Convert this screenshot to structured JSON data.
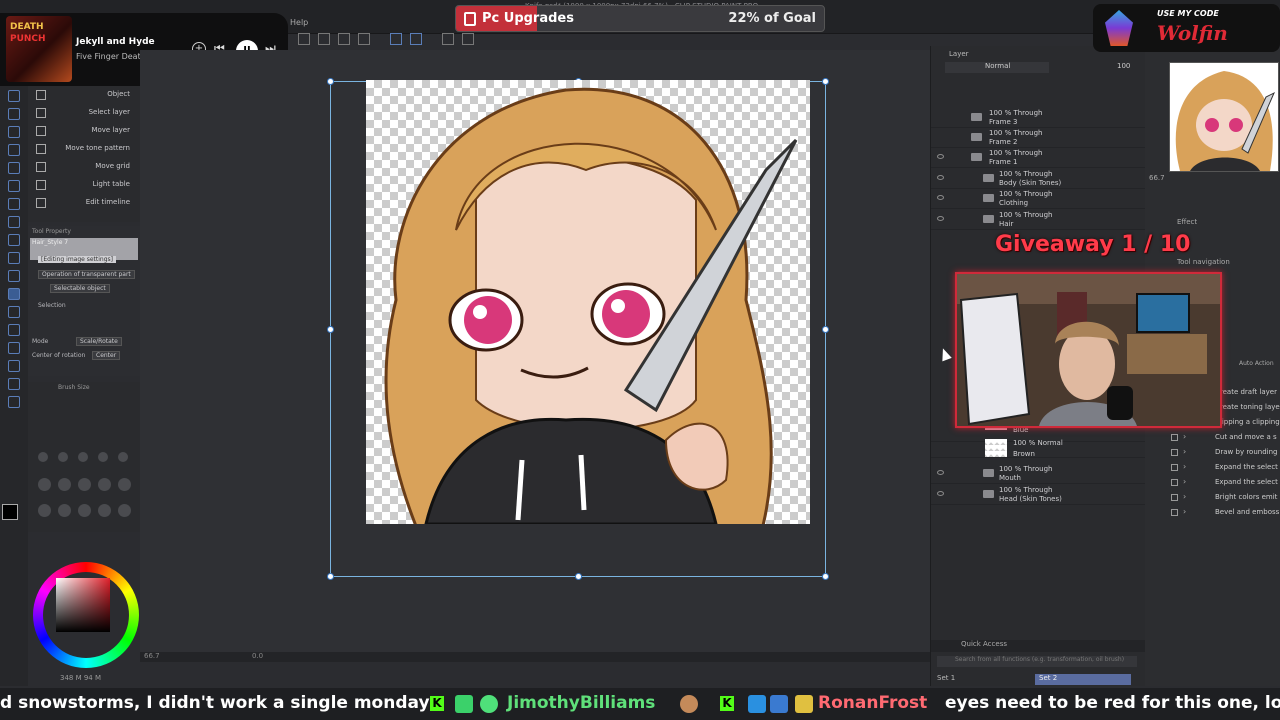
{
  "app": {
    "menu_help": "Help",
    "window_title": "Knife.psd* (1000 x 1000px 72dpi 66.7%) - CLIP STUDIO PAINT PRO"
  },
  "goal": {
    "label": "Pc Upgrades",
    "percent_text": "22% of Goal",
    "progress": 0.22,
    "fill_color": "#c3303a"
  },
  "music": {
    "album_line1": "DEATH",
    "album_line2": "PUNCH",
    "title": "Jekyll and Hyde",
    "artist": "Five Finger Death Punch",
    "controls": {
      "add": "+",
      "prev": "⏮",
      "pause": "II",
      "next": "⏭"
    }
  },
  "subtools": [
    {
      "label": "Object",
      "icon": "arrow-icon"
    },
    {
      "label": "Select layer",
      "icon": "select-layer-icon"
    },
    {
      "label": "Move layer",
      "icon": "move-icon"
    },
    {
      "label": "Move tone pattern",
      "icon": "move-icon"
    },
    {
      "label": "Move grid",
      "icon": "move-icon"
    },
    {
      "label": "Light table",
      "icon": "light-table-icon"
    },
    {
      "label": "Edit timeline",
      "icon": "timeline-icon"
    }
  ],
  "tool_property": {
    "title": "Tool Property",
    "preset": "Hair_Style 7",
    "editing": "[Editing image settings]",
    "operation": "Operation of transparent part",
    "selectable": "Selectable object",
    "selection_label": "Selection",
    "mode_label": "Mode",
    "mode_value": "Scale/Rotate",
    "center_label": "Center of rotation",
    "center_value": "Center"
  },
  "brush_size": {
    "title": "Brush Size"
  },
  "status_left": {
    "coords": "348 M  94 M",
    "value": "0"
  },
  "canvas": {
    "zoom": "66.7",
    "angle": "0.0"
  },
  "layers": {
    "tab": "Layer",
    "blend_mode": "Normal",
    "opacity": "100",
    "rows": [
      {
        "line1": "100 % Through",
        "line2": "Frame 3",
        "indent": 0
      },
      {
        "line1": "100 % Through",
        "line2": "Frame 2",
        "indent": 0
      },
      {
        "line1": "100 % Through",
        "line2": "Frame 1",
        "indent": 0
      },
      {
        "line1": "100 % Through",
        "line2": "Body (Skin Tones)",
        "indent": 1
      },
      {
        "line1": "100 % Through",
        "line2": "Clothing",
        "indent": 1
      },
      {
        "line1": "100 % Through",
        "line2": "Hair",
        "indent": 1
      }
    ],
    "rows_lower": [
      {
        "line1": "",
        "line2": "Blue",
        "swatch": "#e8a0b4"
      },
      {
        "line1": "100 % Normal",
        "line2": "Brown",
        "swatch": ""
      },
      {
        "line1": "100 % Through",
        "line2": "Mouth",
        "swatch": ""
      },
      {
        "line1": "100 % Through",
        "line2": "Head (Skin Tones)",
        "swatch": ""
      }
    ],
    "quick_access": "Quick Access",
    "qa_search_placeholder": "Search from all functions (e.g. transformation, oil brush)",
    "set1": "Set 1",
    "set2": "Set 2"
  },
  "overlay": {
    "giveaway": "Giveaway 1 / 10"
  },
  "right_panel": {
    "zoom": "66.7",
    "effect": "Effect",
    "navigator": "Tool navigation",
    "auto_action": "Auto Action",
    "actions": [
      "Create draft layer",
      "Create toning laye",
      "Clipping a clipping",
      "Cut and move a s",
      "Draw by rounding",
      "Expand the select",
      "Expand the select",
      "Bright colors emit",
      "Bevel and emboss"
    ]
  },
  "streamer": {
    "subtitle": "USE MY CODE",
    "name": "Wolfin"
  },
  "ticker": {
    "message1": "d snowstorms, I didn't work a single monday",
    "user1": "JimothyBilliams",
    "user2": "RonanFrost",
    "message2": "eyes need to be red for this one, lol",
    "badge": "K"
  },
  "colors": {
    "accent_red": "#d02a3a",
    "selection_blue": "#7ab4e0",
    "kick_green": "#53fc18"
  }
}
